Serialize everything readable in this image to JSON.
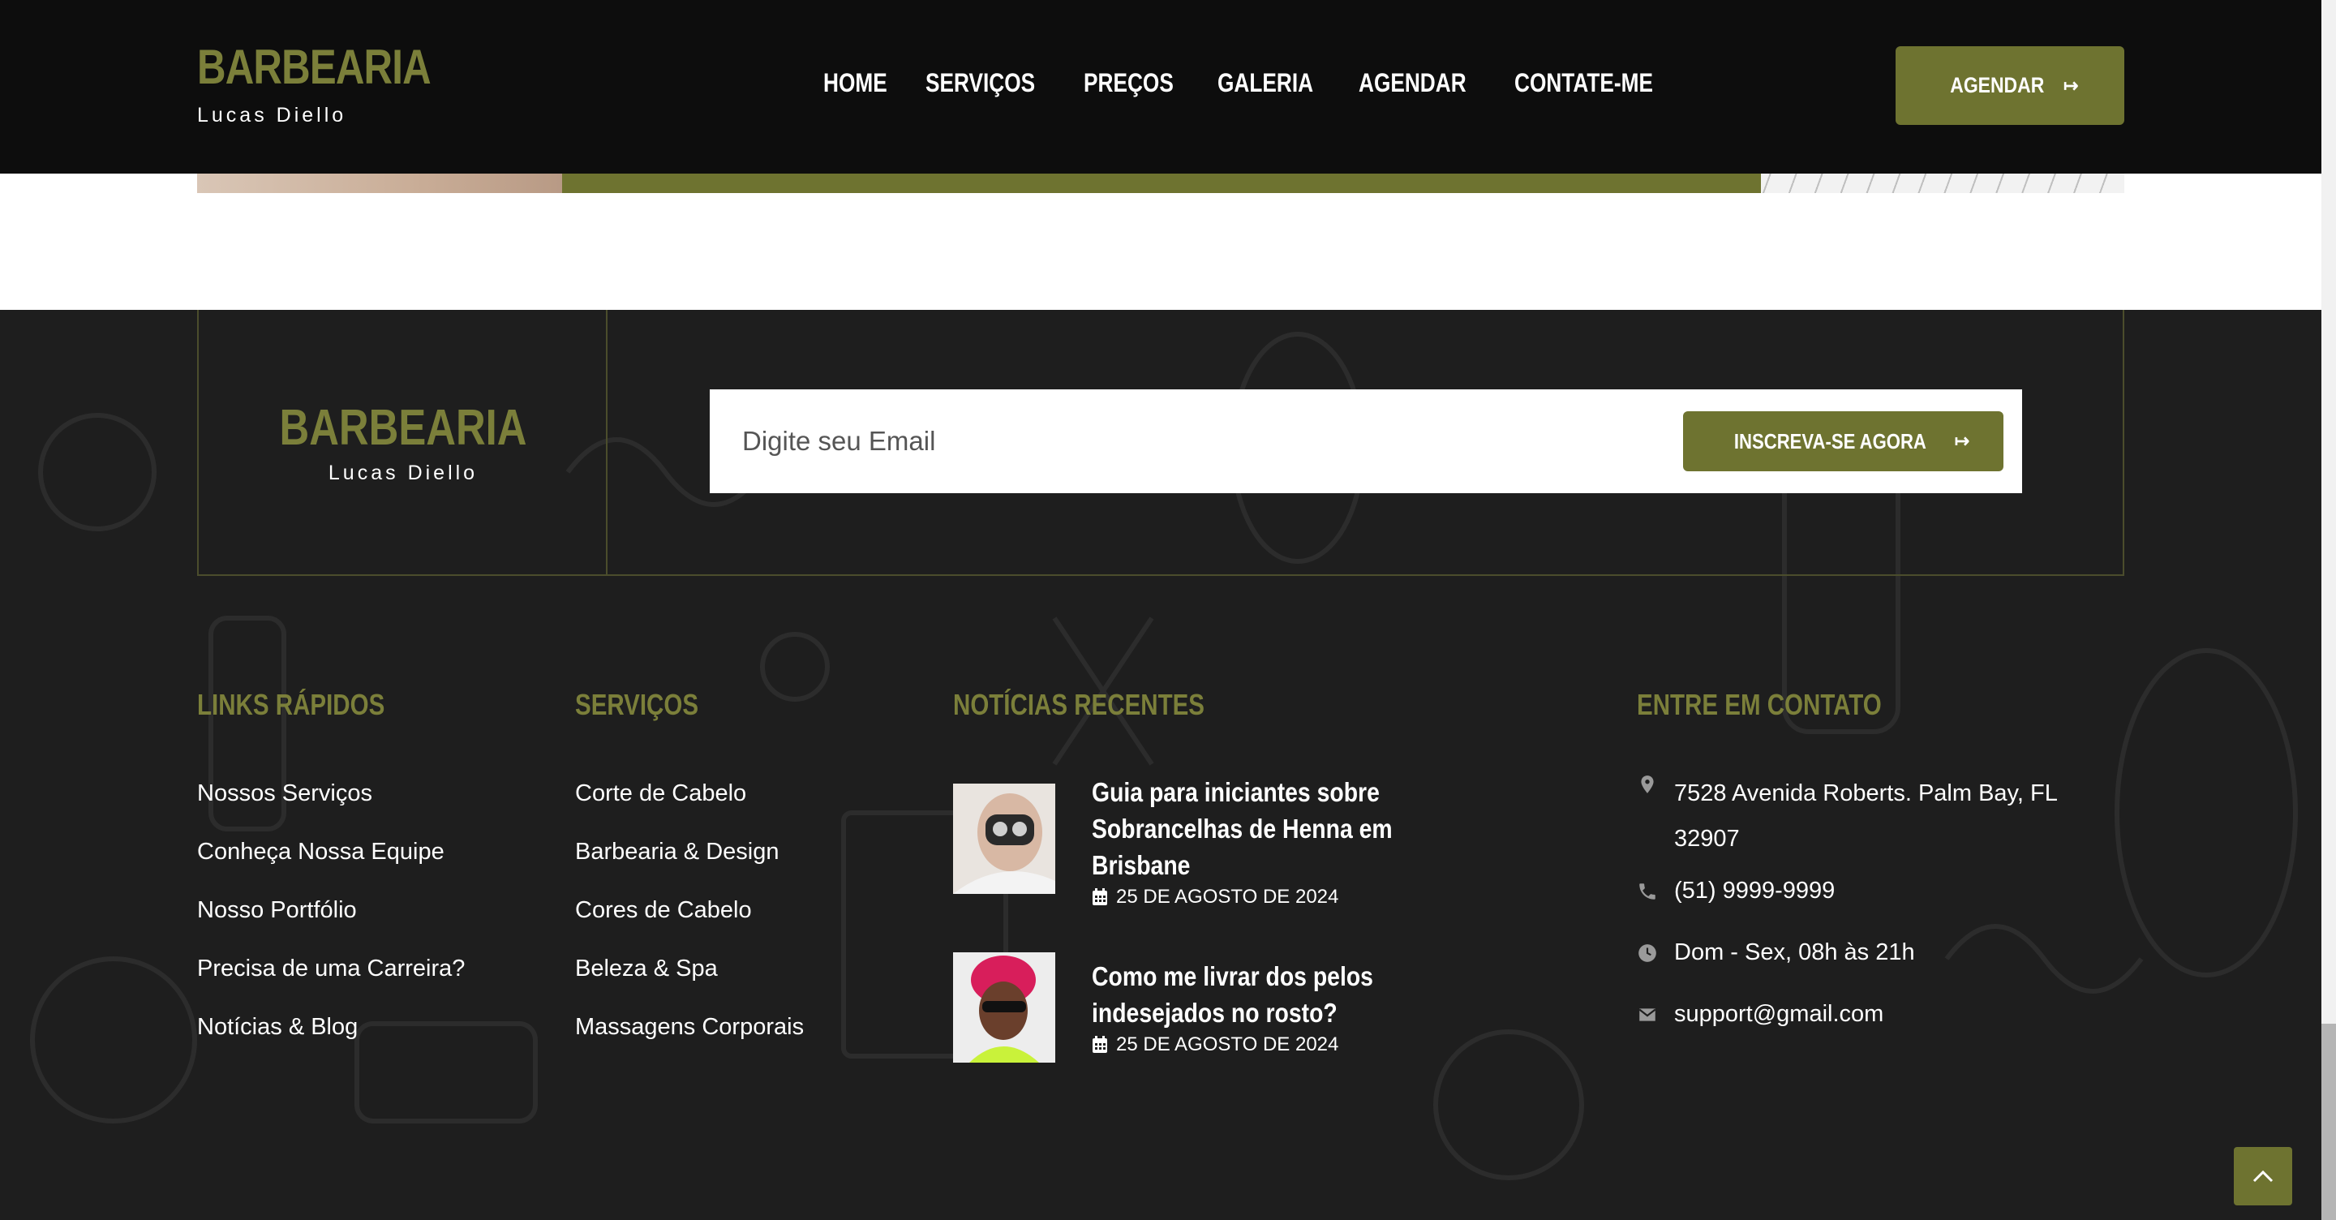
{
  "brand": {
    "title": "BARBEARIA",
    "subtitle": "Lucas Diello"
  },
  "nav": {
    "items": [
      "HOME",
      "SERVIÇOS",
      "PREÇOS",
      "GALERIA",
      "AGENDAR",
      "CONTATE-ME"
    ]
  },
  "header_cta": {
    "label": "AGENDAR",
    "icon": "arrow-right-icon"
  },
  "newsletter": {
    "placeholder": "Digite seu Email",
    "button_label": "INSCREVA-SE AGORA",
    "button_icon": "arrow-right-icon"
  },
  "quick_links": {
    "title": "LINKS RÁPIDOS",
    "items": [
      "Nossos Serviços",
      "Conheça Nossa Equipe",
      "Nosso Portfólio",
      "Precisa de uma Carreira?",
      "Notícias & Blog"
    ]
  },
  "services": {
    "title": "SERVIÇOS",
    "items": [
      "Corte de Cabelo",
      "Barbearia & Design",
      "Cores de Cabelo",
      "Beleza & Spa",
      "Massagens Corporais"
    ]
  },
  "news": {
    "title": "NOTÍCIAS RECENTES",
    "items": [
      {
        "title_lines": [
          "Guia para iniciantes sobre",
          "Sobrancelhas de Henna em",
          "Brisbane"
        ],
        "date": "25 DE AGOSTO DE 2024",
        "date_icon": "calendar-icon"
      },
      {
        "title_lines": [
          "Como me livrar dos pelos",
          "indesejados no rosto?"
        ],
        "date": "25 DE AGOSTO DE 2024",
        "date_icon": "calendar-icon"
      }
    ]
  },
  "contact": {
    "title": "ENTRE EM CONTATO",
    "address_lines": [
      "7528 Avenida Roberts. Palm Bay, FL",
      "32907"
    ],
    "phone": "(51) 9999-9999",
    "hours": "Dom - Sex, 08h às 21h",
    "email": "support@gmail.com",
    "icons": {
      "address": "map-pin-icon",
      "phone": "phone-icon",
      "hours": "clock-icon",
      "email": "mail-icon"
    }
  },
  "colors": {
    "accent": "#6e7330",
    "accent_text": "#7b7f3a",
    "header_bg": "#0d0d0d",
    "footer_bg": "#1e1e1e"
  }
}
